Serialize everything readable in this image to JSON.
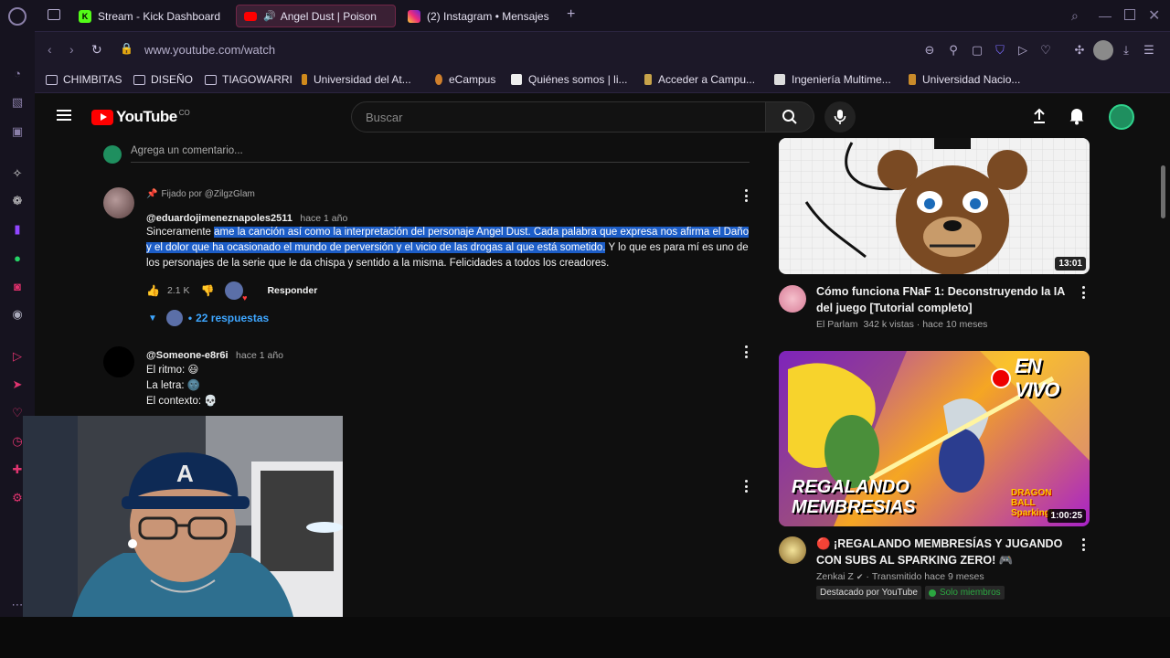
{
  "browser": {
    "tabs": [
      {
        "label": "Stream - Kick Dashboard",
        "favicon": "K"
      },
      {
        "label": "Angel Dust | Poison",
        "favicon": "yt"
      },
      {
        "label": "(2) Instagram • Mensajes",
        "favicon": "ig"
      }
    ],
    "new_tab_label": "+",
    "url": "www.youtube.com/watch",
    "bookmarks": [
      {
        "label": "CHIMBITAS",
        "kind": "folder"
      },
      {
        "label": "DISEÑO",
        "kind": "folder"
      },
      {
        "label": "TIAGOWARRI",
        "kind": "folder"
      },
      {
        "label": "Universidad del At...",
        "kind": "site"
      },
      {
        "label": "eCampus",
        "kind": "site"
      },
      {
        "label": "Quiénes somos | li...",
        "kind": "site"
      },
      {
        "label": "Acceder a Campu...",
        "kind": "site"
      },
      {
        "label": "Ingeniería Multime...",
        "kind": "site"
      },
      {
        "label": "Universidad Nacio...",
        "kind": "site"
      }
    ]
  },
  "youtube": {
    "logo_text": "YouTube",
    "logo_country": "CO",
    "search_placeholder": "Buscar",
    "add_comment_placeholder": "Agrega un comentario...",
    "comments": [
      {
        "pinned_label": "Fijado por @ZilgzGlam",
        "author": "@eduardojimeneznapoles2511",
        "time": "hace 1 año",
        "text_plain_start": "Sinceramente ",
        "text_highlighted_1": "ame la canción así como la interpretación del personaje Angel Dust. Cada palabra que expresa nos afirma el Daño",
        "text_highlighted_2": "y el dolor que ha ocasionado el mundo de perversión y el vicio de las drogas al que está sometido.",
        "text_rest_line2": " Y lo que es para mí es uno de",
        "text_line3": "los personajes de la serie que le da chispa y sentido a la misma. Felicidades a todos los creadores.",
        "likes": "2.1 K",
        "reply_label": "Responder",
        "replies_label": "22 respuestas"
      },
      {
        "author": "@Someone-e8r6i",
        "time": "hace 1 año",
        "lines": [
          "El ritmo: 😃",
          "La letra: 🌚",
          "El contexto: 💀"
        ]
      }
    ],
    "sidebar_videos": [
      {
        "title_line1": "Cómo funciona FNaF 1: Deconstruyendo la IA",
        "title_line2": "del juego [Tutorial completo]",
        "channel": "El Parlam",
        "meta": "342 k vistas · hace 10 meses",
        "duration": "13:01"
      },
      {
        "title_line1": "🔴 ¡REGALANDO MEMBRESÍAS Y JUGANDO",
        "title_line2": "CON SUBS AL SPARKING ZERO! 🎮",
        "channel": "Zenkai Z",
        "meta": "Transmitido hace 9 meses",
        "featured": "Destacado por YouTube",
        "members_badge": "Solo miembros",
        "duration": "1:00:25",
        "thumb_live_text": "EN VIVO",
        "thumb_text_1": "REGALANDO",
        "thumb_text_2": "MEMBRESIAS",
        "thumb_logo": "DRAGON BALL Sparking!"
      }
    ]
  },
  "colors": {
    "selection": "#1c5dc7",
    "yt_red": "#ff0000",
    "gx_bg": "#16131f",
    "members_green": "#2ba640"
  }
}
